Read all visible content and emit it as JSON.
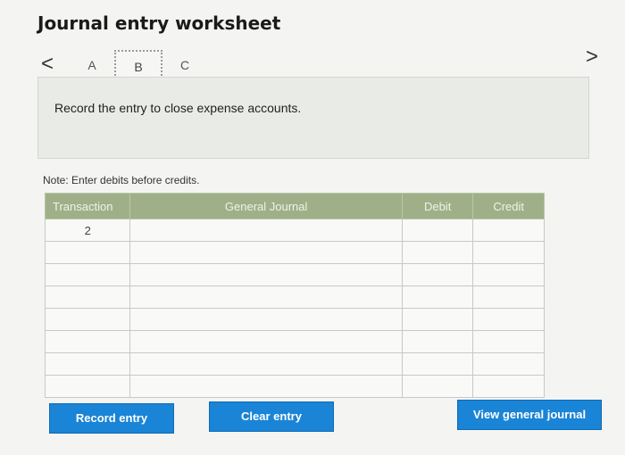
{
  "header": {
    "title": "Journal entry worksheet"
  },
  "tabs": {
    "prev_glyph": "<",
    "next_glyph": ">",
    "items": [
      {
        "label": "A"
      },
      {
        "label": "B",
        "active": true
      },
      {
        "label": "C"
      }
    ]
  },
  "prompt": {
    "text": "Record the entry to close expense accounts."
  },
  "note": {
    "text": "Note: Enter debits before credits."
  },
  "table": {
    "headers": {
      "transaction": "Transaction",
      "general_journal": "General Journal",
      "debit": "Debit",
      "credit": "Credit"
    },
    "rows": [
      {
        "transaction": "2",
        "account": "",
        "debit": "",
        "credit": ""
      },
      {
        "transaction": "",
        "account": "",
        "debit": "",
        "credit": ""
      },
      {
        "transaction": "",
        "account": "",
        "debit": "",
        "credit": ""
      },
      {
        "transaction": "",
        "account": "",
        "debit": "",
        "credit": ""
      },
      {
        "transaction": "",
        "account": "",
        "debit": "",
        "credit": ""
      },
      {
        "transaction": "",
        "account": "",
        "debit": "",
        "credit": ""
      },
      {
        "transaction": "",
        "account": "",
        "debit": "",
        "credit": ""
      },
      {
        "transaction": "",
        "account": "",
        "debit": "",
        "credit": ""
      }
    ]
  },
  "buttons": {
    "record": "Record entry",
    "clear": "Clear entry",
    "view": "View general journal"
  },
  "colors": {
    "header_bg": "#9fb089",
    "button_bg": "#1a84d6",
    "input_border": "#6b8fcf",
    "prompt_bg": "#e9ece6"
  }
}
